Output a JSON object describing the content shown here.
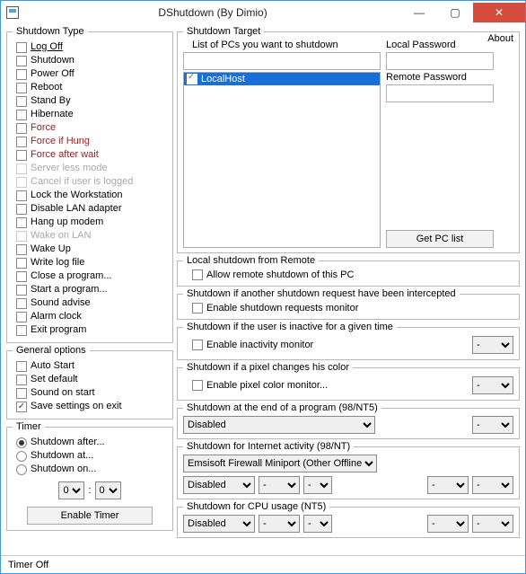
{
  "window": {
    "title": "DShutdown (By Dimio)"
  },
  "about": "About",
  "shutdownType": {
    "legend": "Shutdown Type",
    "items": [
      {
        "label": "Log Off",
        "style": "link"
      },
      {
        "label": "Shutdown"
      },
      {
        "label": "Power Off"
      },
      {
        "label": "Reboot"
      },
      {
        "label": "Stand By"
      },
      {
        "label": "Hibernate"
      },
      {
        "label": "Force",
        "style": "red"
      },
      {
        "label": "Force if Hung",
        "style": "red"
      },
      {
        "label": "Force after wait",
        "style": "red"
      },
      {
        "label": "Server less mode",
        "style": "dim"
      },
      {
        "label": "Cancel if user is logged",
        "style": "dim"
      },
      {
        "label": "Lock the Workstation"
      },
      {
        "label": "Disable LAN adapter"
      },
      {
        "label": "Hang up modem"
      },
      {
        "label": "Wake on LAN",
        "style": "dim"
      },
      {
        "label": "Wake Up"
      },
      {
        "label": "Write log file"
      },
      {
        "label": "Close a program..."
      },
      {
        "label": "Start a program..."
      },
      {
        "label": "Sound advise"
      },
      {
        "label": "Alarm clock"
      },
      {
        "label": "Exit program"
      }
    ]
  },
  "generalOptions": {
    "legend": "General options",
    "items": [
      {
        "label": "Auto Start",
        "checked": false
      },
      {
        "label": "Set default",
        "checked": false
      },
      {
        "label": "Sound on start",
        "checked": false
      },
      {
        "label": "Save settings on exit",
        "checked": true
      }
    ]
  },
  "timer": {
    "legend": "Timer",
    "modes": [
      {
        "label": "Shutdown after...",
        "checked": true
      },
      {
        "label": "Shutdown at...",
        "checked": false
      },
      {
        "label": "Shutdown on...",
        "checked": false
      }
    ],
    "hour": "0",
    "sep": ":",
    "minute": "0",
    "enableBtn": "Enable Timer"
  },
  "target": {
    "legend": "Shutdown Target",
    "listLabel": "List of PCs you want to shutdown",
    "localPwLabel": "Local Password",
    "remotePwLabel": "Remote Password",
    "host": "LocalHost",
    "getPcBtn": "Get PC list"
  },
  "sections": {
    "remote": {
      "legend": "Local shutdown from Remote",
      "opt": "Allow remote shutdown of this PC"
    },
    "intercept": {
      "legend": "Shutdown if another shutdown request have been intercepted",
      "opt": "Enable shutdown requests monitor"
    },
    "inactive": {
      "legend": "Shutdown if the user is inactive for a given time",
      "opt": "Enable inactivity monitor",
      "val": "-"
    },
    "pixel": {
      "legend": "Shutdown if a pixel changes his color",
      "opt": "Enable pixel color monitor...",
      "val": "-"
    },
    "progEnd": {
      "legend": "Shutdown at the end of a program (98/NT5)",
      "sel": "Disabled",
      "val": "-"
    },
    "internet": {
      "legend": "Shutdown for Internet activity (98/NT)",
      "adapter": "Emsisoft Firewall Miniport (Other Offline)",
      "mode": "Disabled",
      "a": "-",
      "b": "-",
      "c": "-",
      "d": "-"
    },
    "cpu": {
      "legend": "Shutdown for CPU usage (NT5)",
      "mode": "Disabled",
      "a": "-",
      "b": "-",
      "c": "-",
      "d": "-"
    }
  },
  "status": "Timer Off"
}
